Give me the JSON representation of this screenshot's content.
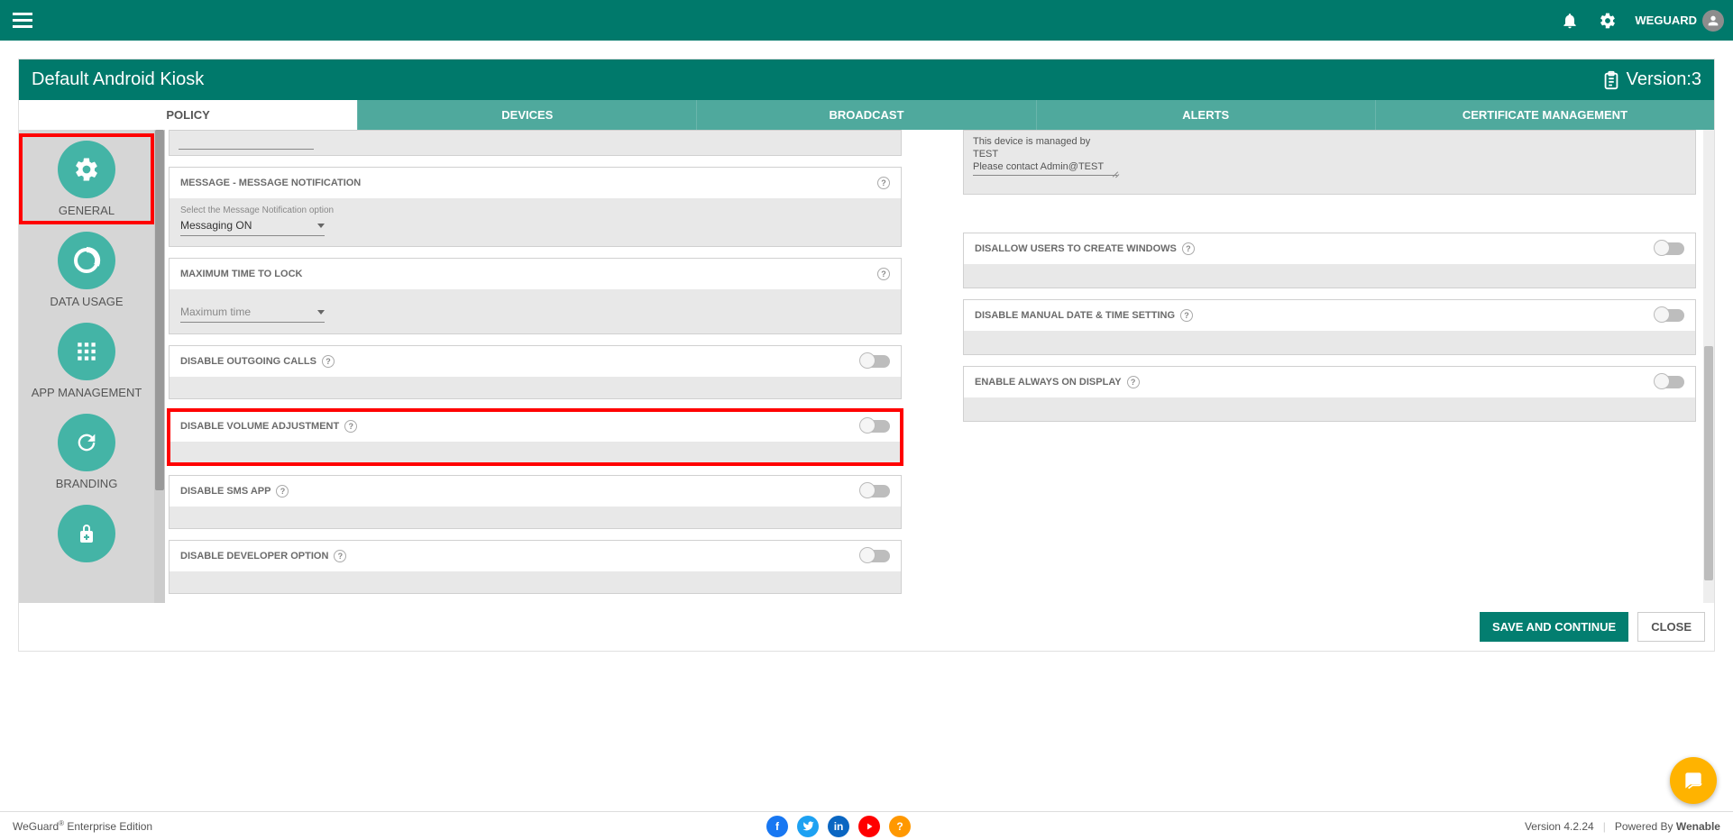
{
  "appbar": {
    "user_label": "WEGUARD"
  },
  "panel": {
    "title": "Default Android Kiosk",
    "version_label": "Version:3"
  },
  "tabs": [
    {
      "label": "POLICY",
      "active": true
    },
    {
      "label": "DEVICES",
      "active": false
    },
    {
      "label": "BROADCAST",
      "active": false
    },
    {
      "label": "ALERTS",
      "active": false
    },
    {
      "label": "CERTIFICATE MANAGEMENT",
      "active": false
    }
  ],
  "sidebar": {
    "items": [
      {
        "label": "GENERAL",
        "icon": "gear",
        "highlighted": true
      },
      {
        "label": "DATA USAGE",
        "icon": "data"
      },
      {
        "label": "APP MANAGEMENT",
        "icon": "apps"
      },
      {
        "label": "BRANDING",
        "icon": "refresh"
      },
      {
        "label": "",
        "icon": "lock"
      }
    ]
  },
  "left_cards": {
    "msg_notification": {
      "title": "MESSAGE - MESSAGE NOTIFICATION",
      "hint": "Select the Message Notification option",
      "value": "Messaging ON"
    },
    "max_lock": {
      "title": "MAXIMUM TIME TO LOCK",
      "placeholder": "Maximum time"
    },
    "disable_outgoing": {
      "title": "DISABLE OUTGOING CALLS"
    },
    "disable_volume": {
      "title": "DISABLE VOLUME ADJUSTMENT"
    },
    "disable_sms": {
      "title": "DISABLE SMS APP"
    },
    "disable_dev": {
      "title": "DISABLE DEVELOPER OPTION"
    }
  },
  "right_cards": {
    "device_msg": {
      "line1": "This device is managed by TEST",
      "line2": "Please contact Admin@TEST"
    },
    "disallow_windows": {
      "title": "DISALLOW USERS TO CREATE WINDOWS"
    },
    "disable_datetime": {
      "title": "DISABLE MANUAL DATE & TIME SETTING"
    },
    "always_on": {
      "title": "ENABLE ALWAYS ON DISPLAY"
    }
  },
  "footer": {
    "save_label": "SAVE AND CONTINUE",
    "close_label": "CLOSE"
  },
  "bottombar": {
    "edition_prefix": "WeGuard",
    "edition_suffix": " Enterprise Edition",
    "version": "Version 4.2.24",
    "powered_prefix": "Powered By ",
    "powered_brand": "Wenable"
  }
}
